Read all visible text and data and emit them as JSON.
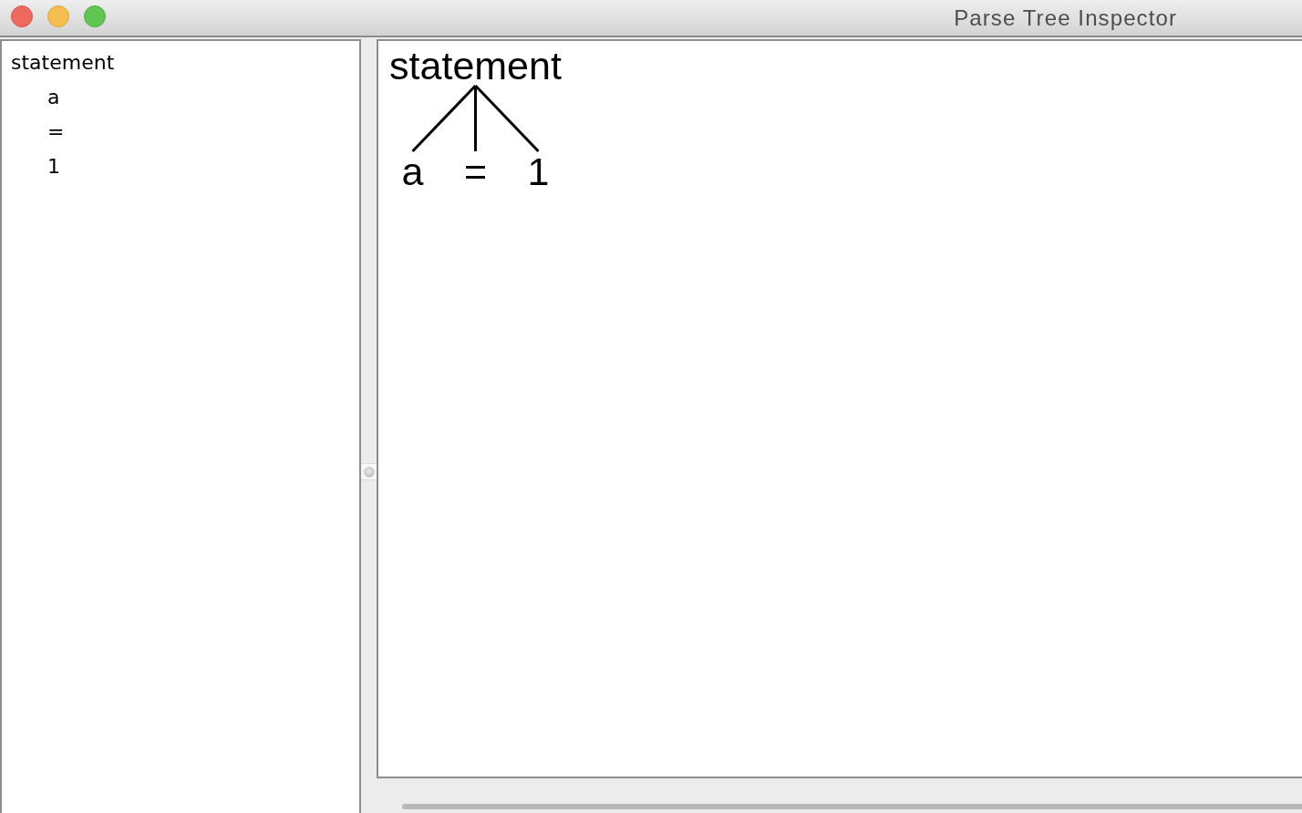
{
  "window": {
    "title": "Parse Tree Inspector"
  },
  "outline": {
    "items": [
      {
        "label": "statement",
        "children": [
          {
            "label": "a"
          },
          {
            "label": "="
          },
          {
            "label": "1"
          }
        ]
      }
    ]
  },
  "parse_tree": {
    "root": {
      "label": "statement",
      "children": [
        {
          "label": "a"
        },
        {
          "label": "="
        },
        {
          "label": "1"
        }
      ]
    }
  }
}
